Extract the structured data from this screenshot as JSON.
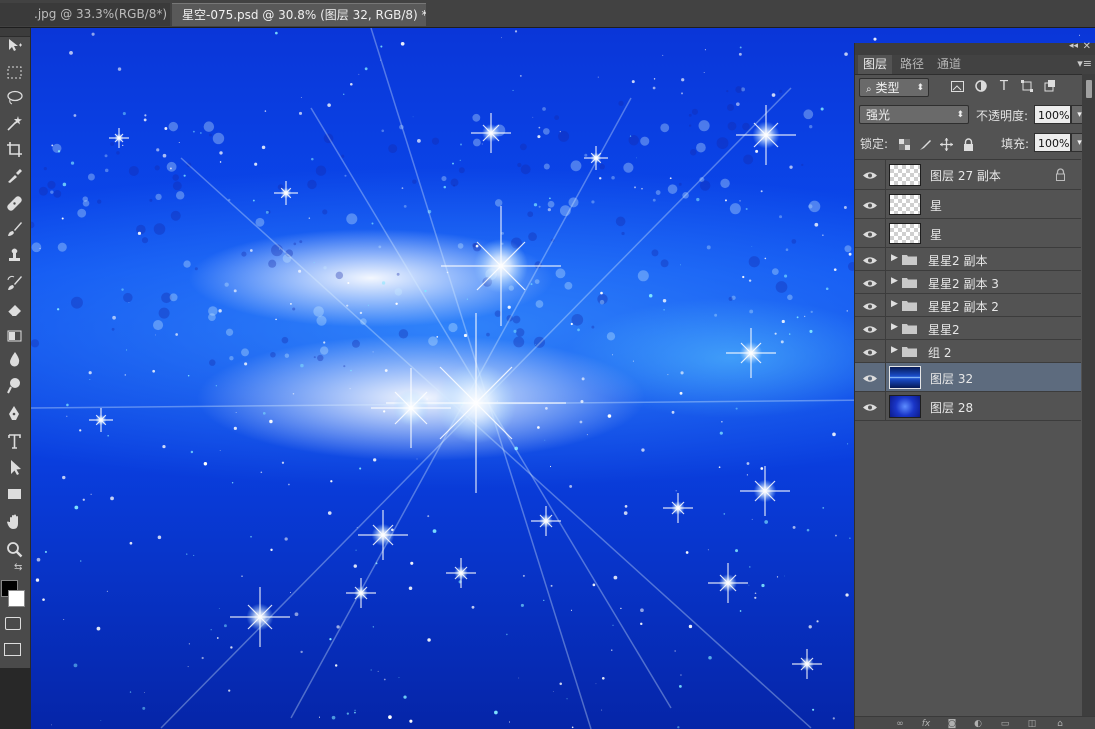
{
  "tabs": [
    {
      "label": ".jpg @ 33.3%(RGB/8*)",
      "close": "×",
      "active": false
    },
    {
      "label": "星空-075.psd @ 30.8% (图层 32, RGB/8) *",
      "close": "×",
      "active": true
    }
  ],
  "tools": [
    {
      "name": "move-tool",
      "icon": "move-icon"
    },
    {
      "name": "marquee-tool",
      "icon": "rect-marquee-icon"
    },
    {
      "name": "lasso-tool",
      "icon": "lasso-icon"
    },
    {
      "name": "magic-wand-tool",
      "icon": "magic-wand-icon"
    },
    {
      "name": "crop-tool",
      "icon": "crop-icon"
    },
    {
      "name": "eyedropper-tool",
      "icon": "eyedropper-icon"
    },
    {
      "name": "healing-brush-tool",
      "icon": "bandage-icon"
    },
    {
      "name": "brush-tool",
      "icon": "brush-icon"
    },
    {
      "name": "clone-stamp-tool",
      "icon": "stamp-icon"
    },
    {
      "name": "history-brush-tool",
      "icon": "history-brush-icon"
    },
    {
      "name": "eraser-tool",
      "icon": "eraser-icon"
    },
    {
      "name": "gradient-tool",
      "icon": "gradient-icon"
    },
    {
      "name": "blur-tool",
      "icon": "blur-drop-icon"
    },
    {
      "name": "dodge-tool",
      "icon": "dodge-icon"
    },
    {
      "name": "pen-tool",
      "icon": "pen-icon"
    },
    {
      "name": "type-tool",
      "icon": "type-icon",
      "label": "T"
    },
    {
      "name": "path-selection-tool",
      "icon": "arrow-icon"
    },
    {
      "name": "rectangle-tool",
      "icon": "rectangle-icon"
    },
    {
      "name": "hand-tool",
      "icon": "hand-icon"
    },
    {
      "name": "zoom-tool",
      "icon": "zoom-icon"
    }
  ],
  "colors": {
    "foreground": "#000000",
    "background": "#ffffff",
    "canvas_accent": "#0b4cf0",
    "selected_layer": "#5d6b7e"
  },
  "panel": {
    "tabs": [
      "图层",
      "路径",
      "通道"
    ],
    "active_tab": "图层",
    "filter": {
      "label": "类型"
    },
    "blend_mode": "强光",
    "opacity_label": "不透明度:",
    "opacity_value": "100%",
    "lock_label": "锁定:",
    "fill_label": "填充:",
    "fill_value": "100%",
    "layers": [
      {
        "name": "图层 27 副本",
        "type": "layer",
        "thumb": "transparent",
        "locked": true,
        "selected": false
      },
      {
        "name": "星",
        "type": "layer",
        "thumb": "transparent",
        "locked": false,
        "selected": false
      },
      {
        "name": "星",
        "type": "layer",
        "thumb": "transparent",
        "locked": false,
        "selected": false
      },
      {
        "name": "星星2 副本",
        "type": "group",
        "locked": false,
        "selected": false
      },
      {
        "name": "星星2 副本 3",
        "type": "group",
        "locked": false,
        "selected": false
      },
      {
        "name": "星星2 副本 2",
        "type": "group",
        "locked": false,
        "selected": false
      },
      {
        "name": "星星2",
        "type": "group",
        "locked": false,
        "selected": false
      },
      {
        "name": "组 2",
        "type": "group",
        "locked": false,
        "selected": false
      },
      {
        "name": "图层 32",
        "type": "layer",
        "thumb": "galaxy",
        "locked": false,
        "selected": true
      },
      {
        "name": "图层 28",
        "type": "layer",
        "thumb": "stars",
        "locked": false,
        "selected": false
      }
    ],
    "footer_icons": [
      "link-icon",
      "fx-icon",
      "mask-icon",
      "adjustment-icon",
      "new-group-icon",
      "new-layer-icon",
      "trash-icon"
    ]
  }
}
